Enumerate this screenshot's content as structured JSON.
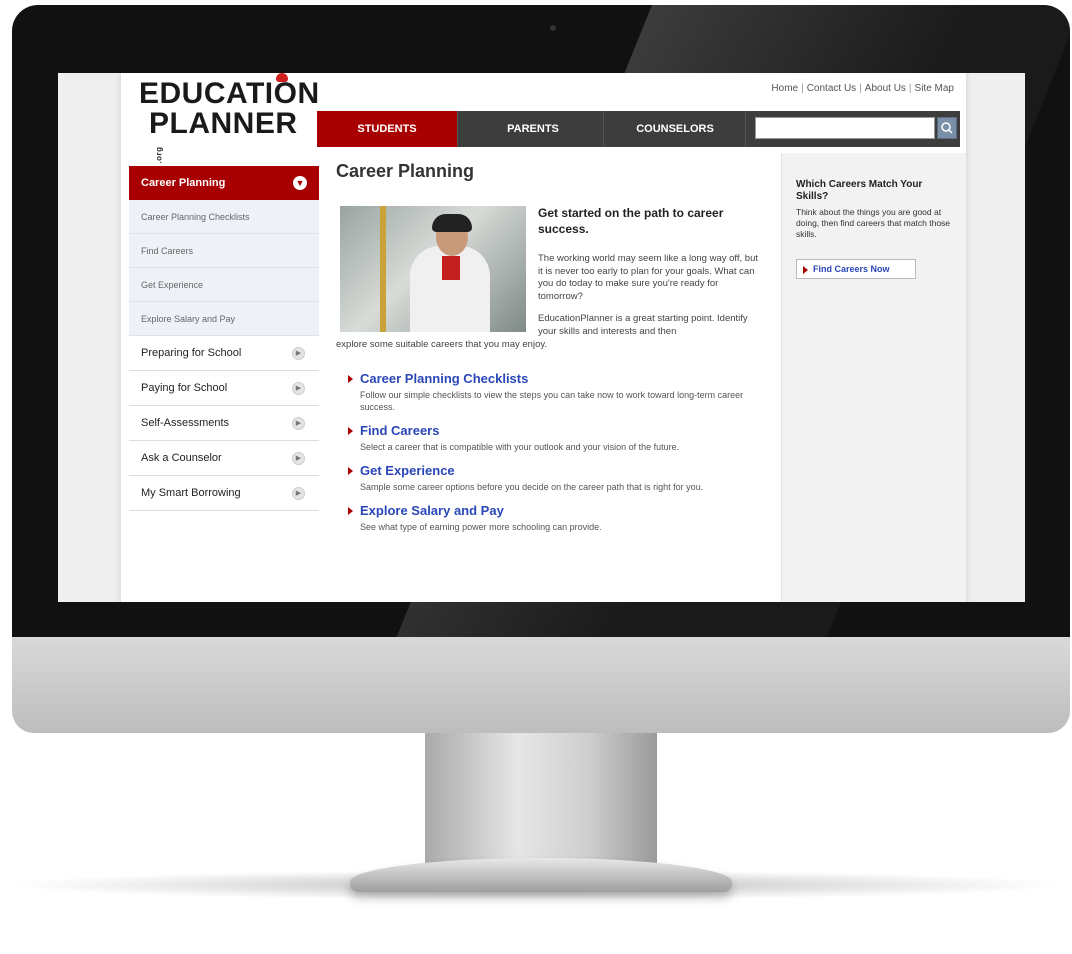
{
  "logo": {
    "line1": "EDUCATION",
    "line2": "PLANNER",
    "suffix": ".org"
  },
  "util_links": [
    "Home",
    "Contact Us",
    "About Us",
    "Site Map"
  ],
  "nav": {
    "tabs": [
      "STUDENTS",
      "PARENTS",
      "COUNSELORS"
    ],
    "search_placeholder": ""
  },
  "sidebar": {
    "active": "Career Planning",
    "subitems": [
      "Career Planning Checklists",
      "Find Careers",
      "Get Experience",
      "Explore Salary and Pay"
    ],
    "items": [
      "Preparing for School",
      "Paying for School",
      "Self-Assessments",
      "Ask a Counselor",
      "My Smart Borrowing"
    ]
  },
  "main": {
    "title": "Career Planning",
    "intro_heading": "Get started on the path to career success.",
    "intro_p1": "The working world may seem like a long way off, but it is never too early to plan for your goals. What can you do today to make sure you're ready for tomorrow?",
    "intro_p2": "EducationPlanner is a great starting point. Identify your skills and interests and then",
    "intro_p2b": "explore some suitable careers that you may enjoy.",
    "links": [
      {
        "title": "Career Planning Checklists",
        "desc": "Follow our simple checklists to view the steps you can take now to work toward long-term career success."
      },
      {
        "title": "Find Careers",
        "desc": "Select a career that is compatible with your outlook and your vision of the future."
      },
      {
        "title": "Get Experience",
        "desc": "Sample some career options before you decide on the career path that is right for you."
      },
      {
        "title": "Explore Salary and Pay",
        "desc": "See what type of earning power more schooling can provide."
      }
    ]
  },
  "right": {
    "heading": "Which Careers Match Your Skills?",
    "text": "Think about the things you are good at doing, then find careers that match those skills.",
    "button": "Find Careers Now"
  },
  "colors": {
    "accent": "#a80000",
    "link": "#2a47b8",
    "nav_bg": "#3d3d3d"
  }
}
